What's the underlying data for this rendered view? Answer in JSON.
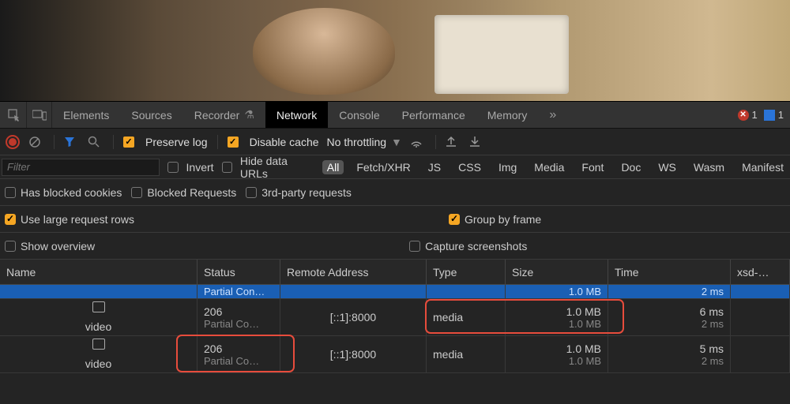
{
  "tabs": {
    "items": [
      "Elements",
      "Sources",
      "Recorder",
      "Network",
      "Console",
      "Performance",
      "Memory"
    ],
    "active_index": 3,
    "errors": "1",
    "messages": "1"
  },
  "toolbar": {
    "preserve_log": "Preserve log",
    "disable_cache": "Disable cache",
    "throttling": "No throttling"
  },
  "filter": {
    "placeholder": "Filter",
    "invert": "Invert",
    "hide_data_urls": "Hide data URLs",
    "types": [
      "All",
      "Fetch/XHR",
      "JS",
      "CSS",
      "Img",
      "Media",
      "Font",
      "Doc",
      "WS",
      "Wasm",
      "Manifest"
    ],
    "active_type_index": 0
  },
  "options_row1": {
    "has_blocked": "Has blocked cookies",
    "blocked_req": "Blocked Requests",
    "third_party": "3rd-party requests"
  },
  "options_row2": {
    "large_rows": "Use large request rows",
    "group_frame": "Group by frame"
  },
  "options_row3": {
    "show_overview": "Show overview",
    "capture": "Capture screenshots"
  },
  "columns": {
    "name": "Name",
    "status": "Status",
    "remote": "Remote Address",
    "type": "Type",
    "size": "Size",
    "time": "Time",
    "extra": "xsd-…"
  },
  "rows": [
    {
      "name": "",
      "status": "",
      "status_sub": "Partial Con…",
      "remote": "",
      "type": "",
      "size": "",
      "size_sub": "1.0 MB",
      "time": "",
      "time_sub": "2 ms",
      "selected": true
    },
    {
      "name": "video",
      "status": "206",
      "status_sub": "Partial Co…",
      "remote": "[::1]:8000",
      "type": "media",
      "size": "1.0 MB",
      "size_sub": "1.0 MB",
      "time": "6 ms",
      "time_sub": "2 ms",
      "selected": false
    },
    {
      "name": "video",
      "status": "206",
      "status_sub": "Partial Co…",
      "remote": "[::1]:8000",
      "type": "media",
      "size": "1.0 MB",
      "size_sub": "1.0 MB",
      "time": "5 ms",
      "time_sub": "2 ms",
      "selected": false
    }
  ]
}
